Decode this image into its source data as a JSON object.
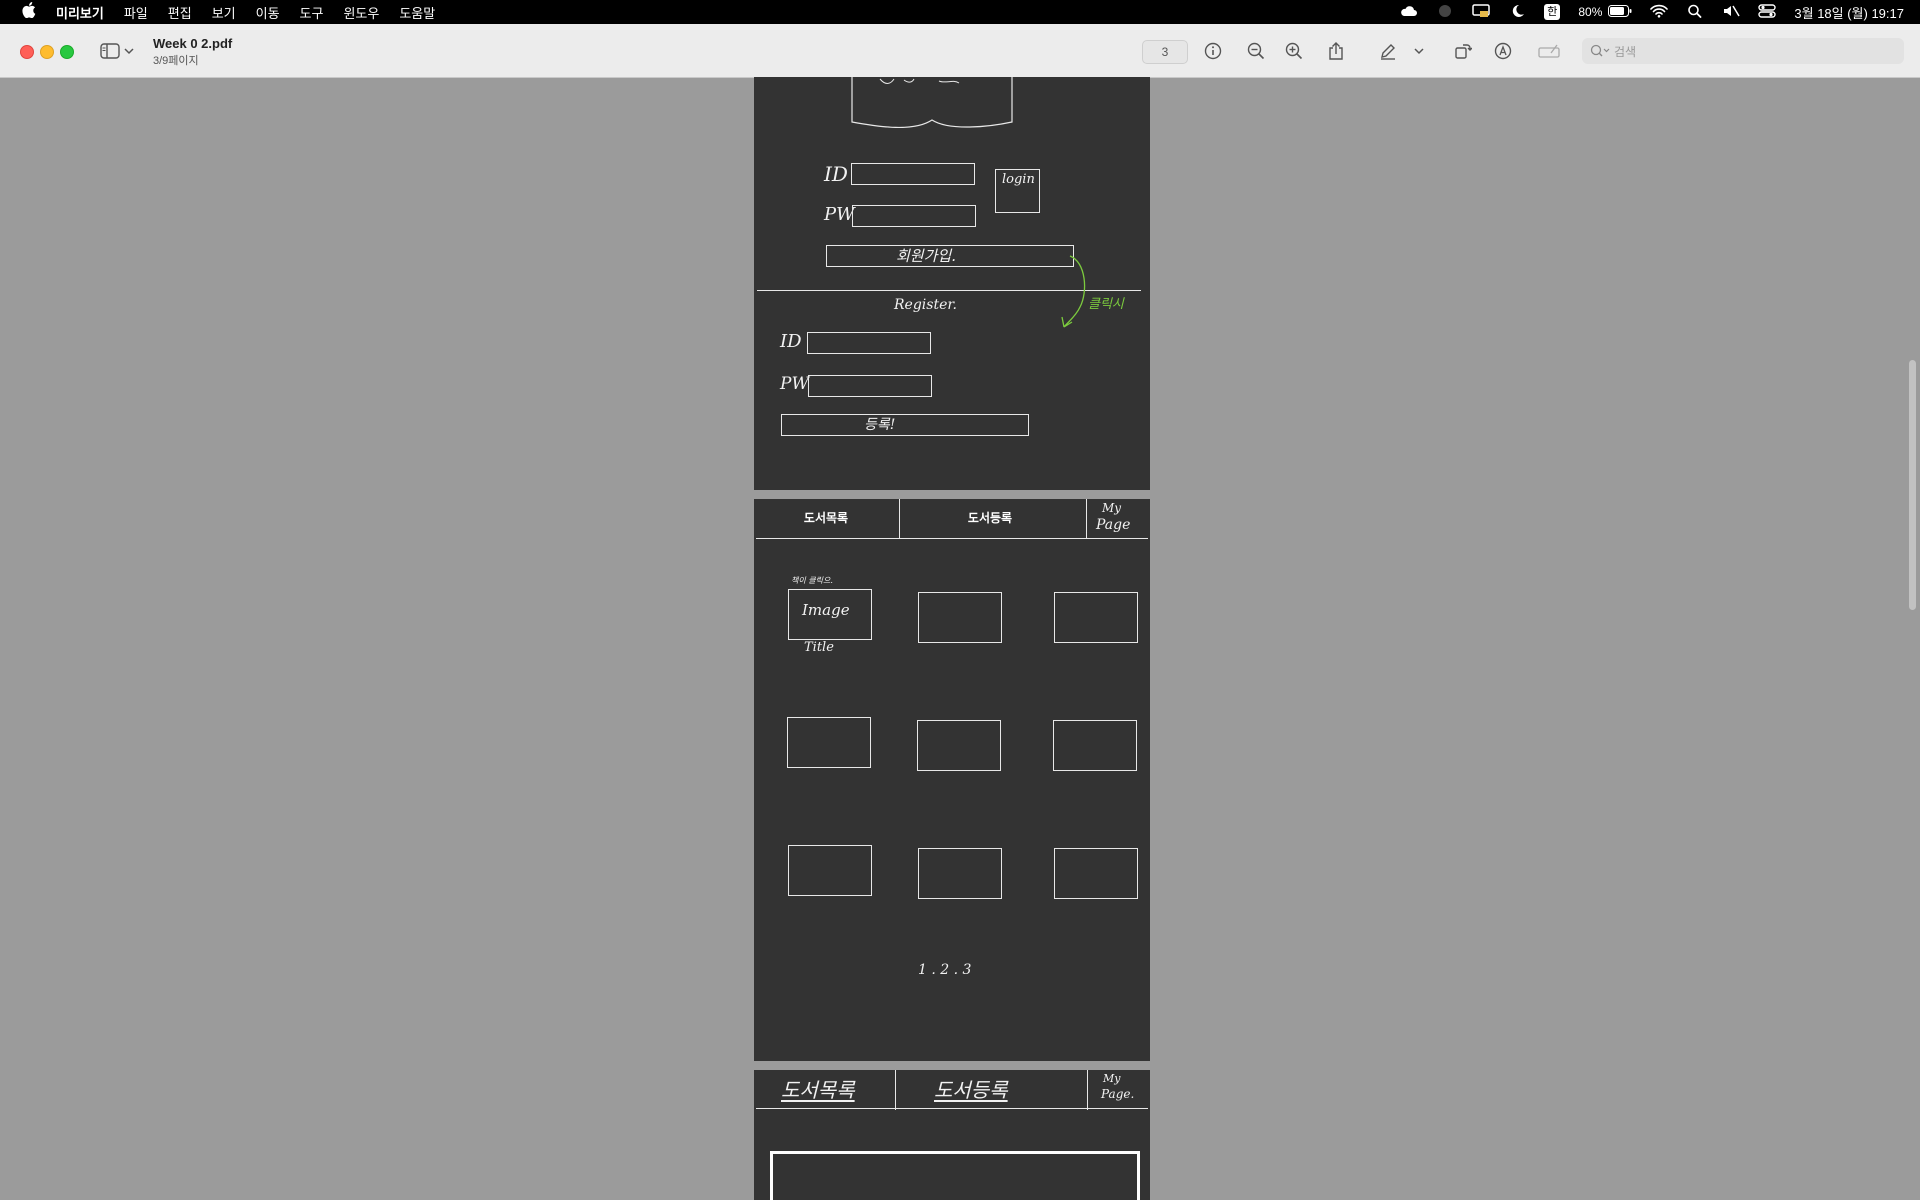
{
  "menubar": {
    "app_name": "미리보기",
    "menus": [
      "파일",
      "편집",
      "보기",
      "이동",
      "도구",
      "윈도우",
      "도움말"
    ],
    "battery": "80%",
    "input_method": "한",
    "datetime": "3월 18일 (월) 19:17"
  },
  "toolbar": {
    "doc_title": "Week 0 2.pdf",
    "doc_subtitle": "3/9페이지",
    "page_number": "3",
    "search_placeholder": "검색"
  },
  "page1": {
    "id_label": "ID",
    "pw_label": "PW",
    "login_label": "login",
    "signup_label": "회원가입.",
    "click_note": "클릭시",
    "register_title": "Register.",
    "reg_id_label": "ID",
    "reg_pw_label": "PW",
    "reg_submit_label": "등록!"
  },
  "page2": {
    "tab_list": "도서목록",
    "tab_register": "도서등록",
    "tab_mypage_1": "My",
    "tab_mypage_2": "Page",
    "book_note": "책이 클릭으.",
    "image_label": "Image",
    "title_label": "Title",
    "pagination": "1 . 2 . 3"
  },
  "page3": {
    "tab_list": "도서목록",
    "tab_register": "도서등록",
    "tab_mypage_1": "My",
    "tab_mypage_2": "Page."
  }
}
